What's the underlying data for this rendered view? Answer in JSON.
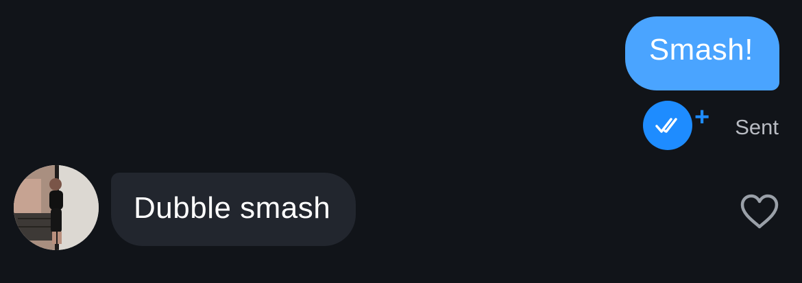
{
  "conversation": {
    "outgoing_message": {
      "text": "Smash!",
      "status": "Sent",
      "receipt_icon": "double-check-icon",
      "receipt_badge": "+"
    },
    "incoming_message": {
      "text": "Dubble smash",
      "avatar": "avatar",
      "like_icon": "heart-icon"
    }
  },
  "colors": {
    "background": "#111419",
    "outgoing_bubble": "#4aa4ff",
    "incoming_bubble": "#22262e",
    "receipt": "#1e8cff",
    "status_text": "#b9bcc3",
    "heart_outline": "#9aa0a8"
  }
}
